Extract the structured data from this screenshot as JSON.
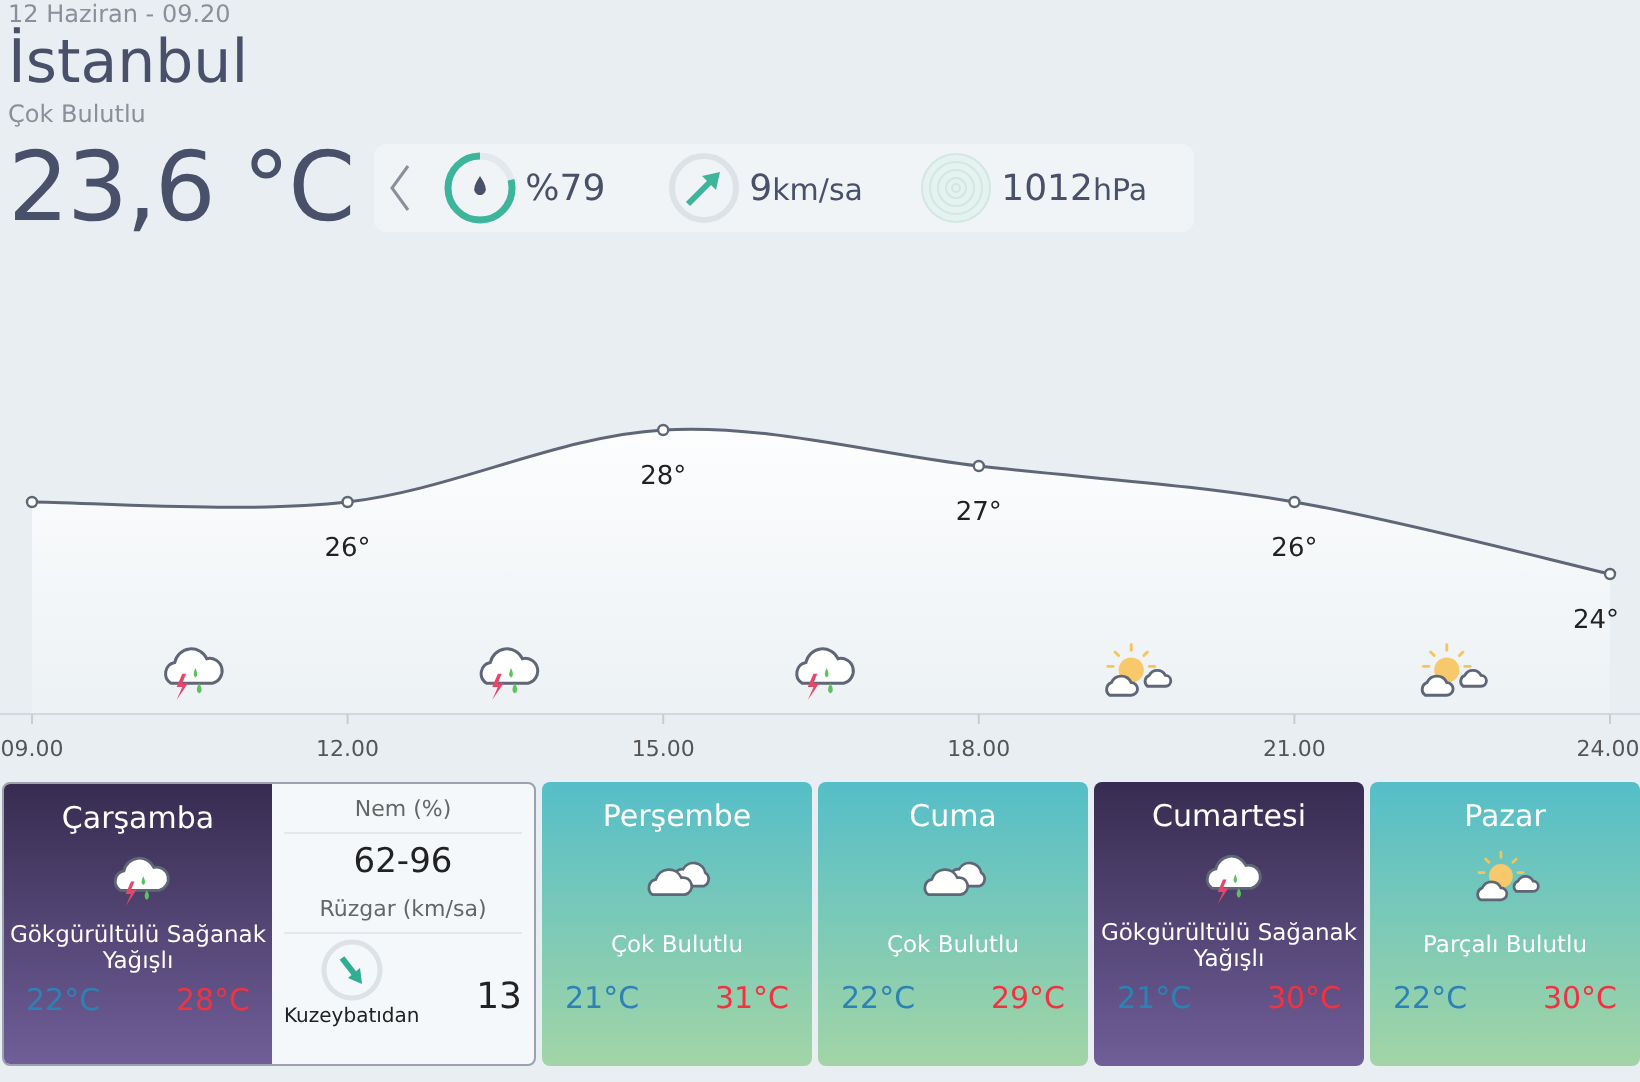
{
  "header": {
    "datetime": "12 Haziran - 09.20",
    "city": "İstanbul",
    "condition": "Çok Bulutlu",
    "temperature": "23,6 °C"
  },
  "metrics": {
    "humidity": {
      "value": "%79",
      "level": 0.79
    },
    "wind": {
      "value": "9",
      "unit": "km/sa"
    },
    "pressure": {
      "value": "1012",
      "unit": "hPa"
    }
  },
  "hourly": {
    "chart_data": {
      "type": "area",
      "marker": "o",
      "categories": [
        "09.00",
        "12.00",
        "15.00",
        "18.00",
        "21.00",
        "24.00"
      ],
      "values": [
        26,
        26,
        28,
        27,
        26,
        24
      ],
      "value_labels": [
        null,
        "26°",
        "28°",
        "27°",
        "26°",
        "24°"
      ]
    },
    "icons": [
      {
        "kind": "storm"
      },
      {
        "kind": "storm"
      },
      {
        "kind": "storm"
      },
      {
        "kind": "partly"
      },
      {
        "kind": "partly"
      }
    ]
  },
  "days": [
    {
      "name": "Çarşamba",
      "kind": "storm",
      "description": "Gökgürültülü Sağanak Yağışlı",
      "low": "22°C",
      "high": "28°C",
      "selected": true
    },
    {
      "name": "Perşembe",
      "kind": "cloudy",
      "description": "Çok Bulutlu",
      "low": "21°C",
      "high": "31°C",
      "selected": false
    },
    {
      "name": "Cuma",
      "kind": "cloudy",
      "description": "Çok Bulutlu",
      "low": "22°C",
      "high": "29°C",
      "selected": false
    },
    {
      "name": "Cumartesi",
      "kind": "storm",
      "description": "Gökgürültülü Sağanak Yağışlı",
      "low": "21°C",
      "high": "30°C",
      "selected": false
    },
    {
      "name": "Pazar",
      "kind": "partly",
      "description": "Parçalı Bulutlu",
      "low": "22°C",
      "high": "30°C",
      "selected": false
    }
  ],
  "detail": {
    "humidity_label": "Nem (%)",
    "humidity": "62-96",
    "wind_label": "Rüzgar (km/sa)",
    "wind_direction": "Kuzeybatıdan",
    "wind_speed": "13"
  }
}
